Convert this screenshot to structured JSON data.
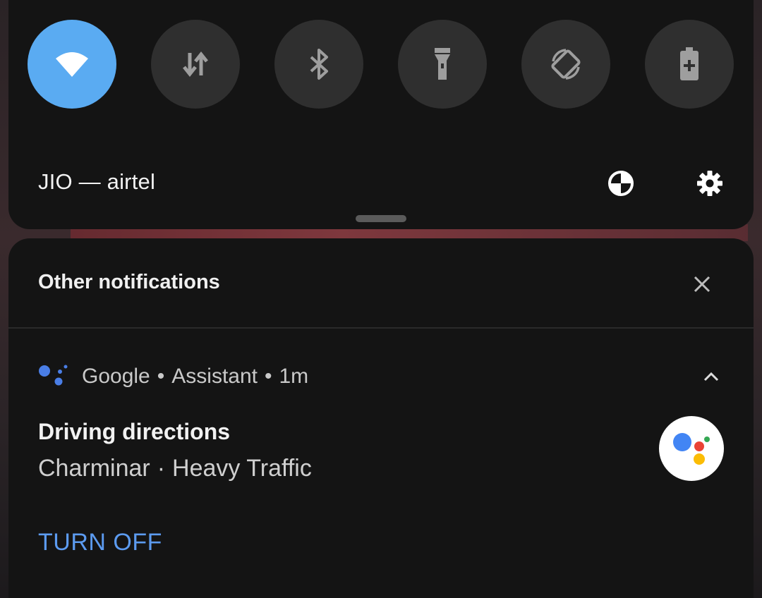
{
  "quick_settings": {
    "tiles": [
      {
        "name": "wifi",
        "icon": "wifi-icon",
        "active": true
      },
      {
        "name": "mobile-data",
        "icon": "data-arrows-icon",
        "active": false
      },
      {
        "name": "bluetooth",
        "icon": "bluetooth-icon",
        "active": false
      },
      {
        "name": "flashlight",
        "icon": "flashlight-icon",
        "active": false
      },
      {
        "name": "auto-rotate",
        "icon": "rotate-icon",
        "active": false
      },
      {
        "name": "battery-saver",
        "icon": "battery-plus-icon",
        "active": false
      }
    ],
    "network_label": "JIO — airtel",
    "colors": {
      "active_tile": "#5aabf2",
      "inactive_tile": "#2f2f2f",
      "panel": "#141414"
    }
  },
  "notifications": {
    "section_title": "Other notifications",
    "item": {
      "app_name": "Google",
      "channel": "Assistant",
      "time": "1m",
      "separator": "•",
      "title": "Driving directions",
      "place": "Charminar",
      "text_separator": "·",
      "status": "Heavy Traffic",
      "action_label": "TURN OFF",
      "action_color": "#5c9bf0"
    }
  }
}
